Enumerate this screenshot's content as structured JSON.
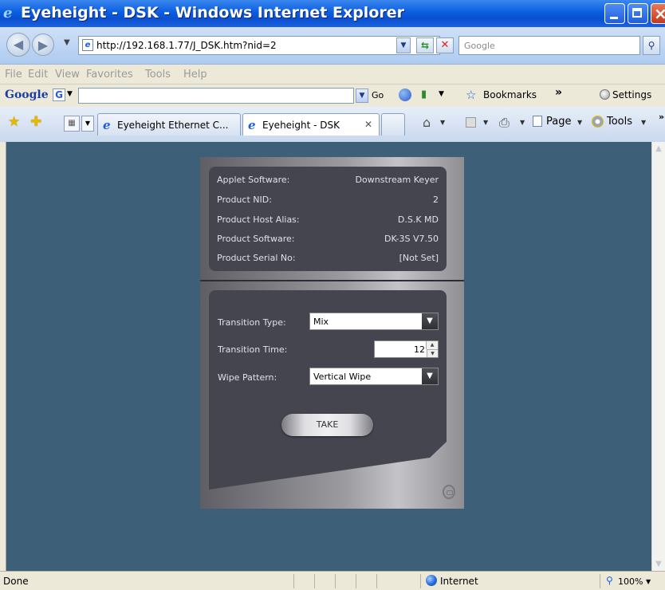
{
  "window": {
    "title": "Eyeheight - DSK - Windows Internet Explorer"
  },
  "address": {
    "url": "http://192.168.1.77/J_DSK.htm?nid=2",
    "search_placeholder": "Google"
  },
  "menu": {
    "items": [
      "File",
      "Edit",
      "View",
      "Favorites",
      "Tools",
      "Help"
    ]
  },
  "google_toolbar": {
    "logo": "Google",
    "go_label": "Go",
    "bookmarks_label": "Bookmarks",
    "settings_label": "Settings"
  },
  "tabs": [
    {
      "label": "Eyeheight Ethernet C...",
      "active": false
    },
    {
      "label": "Eyeheight - DSK",
      "active": true
    }
  ],
  "command_bar": {
    "page_label": "Page",
    "tools_label": "Tools"
  },
  "applet": {
    "info": [
      {
        "label": "Applet Software:",
        "value": "Downstream Keyer"
      },
      {
        "label": "Product NID:",
        "value": "2"
      },
      {
        "label": "Product Host Alias:",
        "value": "D.S.K MD"
      },
      {
        "label": "Product Software:",
        "value": "DK-3S V7.50"
      },
      {
        "label": "Product Serial No:",
        "value": "[Not Set]"
      }
    ],
    "transition_type": {
      "label": "Transition Type:",
      "value": "Mix"
    },
    "transition_time": {
      "label": "Transition Time:",
      "value": "12"
    },
    "wipe_pattern": {
      "label": "Wipe Pattern:",
      "value": "Vertical Wipe"
    },
    "take_label": "TAKE"
  },
  "status": {
    "text": "Done",
    "zone": "Internet",
    "zoom": "100%"
  },
  "icons": [
    "ie-logo-icon",
    "back-arrow-icon",
    "forward-arrow-icon",
    "refresh-icon",
    "stop-icon",
    "search-icon",
    "star-icon",
    "add-favorite-icon",
    "home-icon",
    "print-icon",
    "page-icon",
    "gear-icon",
    "globe-icon",
    "zoom-icon"
  ]
}
